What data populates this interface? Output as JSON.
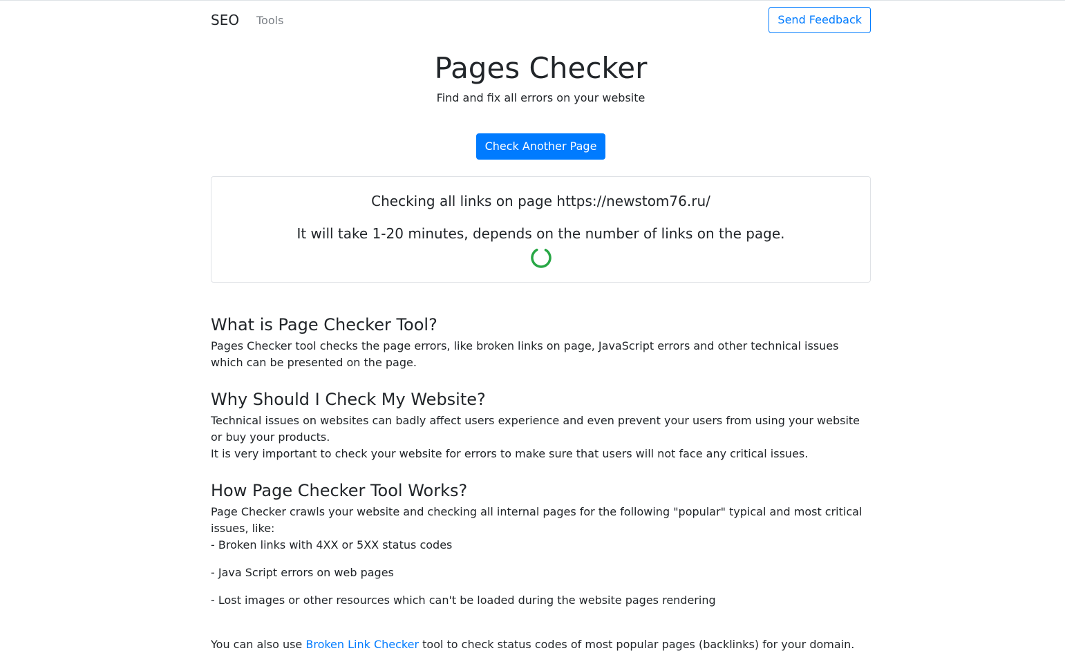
{
  "navbar": {
    "brand": "SEO",
    "tools_link": "Tools",
    "feedback_button": "Send Feedback"
  },
  "hero": {
    "title": "Pages Checker",
    "subtitle": "Find and fix all errors on your website",
    "check_button": "Check Another Page"
  },
  "status": {
    "line1": "Checking all links on page https://newstom76.ru/",
    "line2": "It will take 1-20 minutes, depends on the number of links on the page.",
    "spinner_color": "#28a745"
  },
  "sections": {
    "what": {
      "heading": "What is Page Checker Tool?",
      "text": "Pages Checker tool checks the page errors, like broken links on page, JavaScript errors and other technical issues which can be presented on the page."
    },
    "why": {
      "heading": "Why Should I Check My Website?",
      "text1": "Technical issues on websites can badly affect users experience and even prevent your users from using your website or buy your products.",
      "text2": "It is very important to check your website for errors to make sure that users will not face any critical issues."
    },
    "how": {
      "heading": "How Page Checker Tool Works?",
      "intro": "Page Checker crawls your website and checking all internal pages for the following \"popular\" typical and most critical issues, like:",
      "bullets": [
        "- Broken links with 4XX or 5XX status codes",
        "- Java Script errors on web pages",
        "- Lost images or other resources which can't be loaded during the website pages rendering"
      ]
    }
  },
  "footer_note": {
    "prefix": "You can also use ",
    "link": "Broken Link Checker",
    "suffix": " tool to check status codes of most popular pages (backlinks) for your domain."
  },
  "colors": {
    "primary": "#007bff",
    "text": "#212529",
    "muted": "#7a7f85",
    "spinner": "#28a745"
  }
}
